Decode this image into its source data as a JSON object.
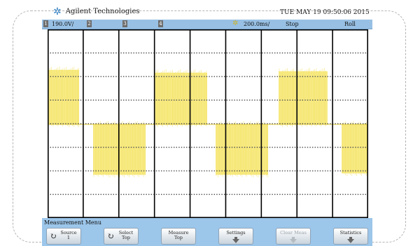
{
  "brand": {
    "name": "Agilent Technologies",
    "logo_icon": "agilent-spark-icon"
  },
  "datetime": "TUE MAY 19 09:50:06 2015",
  "status_bar": {
    "channel1_number": "1",
    "channel1_scale": "190.0V/",
    "channel2_number": "2",
    "channel3_number": "3",
    "channel4_number": "4",
    "trigger_icon": "trigger-spark-icon",
    "timebase": "200.0ms/",
    "run_state": "Stop",
    "mode": "Roll"
  },
  "colors": {
    "waveform": "#f7ea7c",
    "status_bar": "#98c0e4",
    "menu": "#9cc6ea",
    "grid_line": "#000000",
    "grid_dot": "#555555"
  },
  "menu": {
    "title": "Measurement Menu",
    "softkeys": [
      {
        "label": "Source",
        "sub": "1",
        "icon": "rotate-knob-icon",
        "enabled": true
      },
      {
        "label": "Select",
        "sub": "Top",
        "icon": "rotate-knob-icon",
        "enabled": true
      },
      {
        "label": "Measure",
        "sub": "Top",
        "icon": "",
        "enabled": true
      },
      {
        "label": "Settings",
        "sub": "",
        "icon": "submenu-arrow-icon",
        "enabled": true
      },
      {
        "label": "Clear Meas",
        "sub": "",
        "icon": "submenu-arrow-icon",
        "enabled": false
      },
      {
        "label": "Statistics",
        "sub": "",
        "icon": "submenu-arrow-icon",
        "enabled": true
      }
    ]
  }
}
